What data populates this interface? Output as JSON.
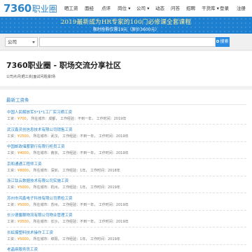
{
  "nav": {
    "logo_num": "7360",
    "logo_text": "职业圈",
    "items": [
      "晒工资",
      "面经",
      "点评",
      "岗位",
      "公司",
      "动态",
      "问答",
      "招聘",
      "干货库"
    ],
    "login": "登录",
    "register": "注册"
  },
  "banner": {
    "headline": "2019最新成为HR专家的100门必修课全套课程",
    "subline": "限时抢购仅需19元（原价3600元）"
  },
  "search": {
    "category": "公司",
    "query": "",
    "button": "搜索"
  },
  "company": {
    "title": "7360职业圈 - 职场交流分享社区",
    "subtitle": "公司点评|晒工资|面试问题|职场"
  },
  "jobs_section": {
    "heading": "最新工资条",
    "items": [
      {
        "name": "中国人民解放军5*1*1工厂实习晒工资",
        "salary": "¥700",
        "city": "成都",
        "exp": "不到一年",
        "year": "2019年"
      },
      {
        "name": "武汉鑫灵创信息技术有限公司销售工资",
        "salary": "¥2500",
        "city": "武汉",
        "exp": "不到一年",
        "year": "2019年"
      },
      {
        "name": "中国邮政储蓄银行有限行柜员工资",
        "salary": "¥4000",
        "city": "南京",
        "exp": "不到一年",
        "year": "2019年"
      },
      {
        "name": "京和通通工程师工资",
        "salary": "¥8000",
        "city": "深圳",
        "exp": "1年",
        "year": "2018年"
      },
      {
        "name": "浙江钛云数据技术有限公司实施工资",
        "salary": "¥5000",
        "city": "杭州",
        "exp": "1年",
        "year": "2019年"
      },
      {
        "name": "苏州市鸿鑫电子科技有限公司质检工资",
        "salary": "¥5000",
        "city": "苏州",
        "exp": "不到一年",
        "year": "2019年"
      },
      {
        "name": "长沙德馨酿物流有限公司物业管理工资",
        "salary": "¥3500",
        "city": "长沙",
        "exp": "不到一年",
        "year": "2019年"
      },
      {
        "name": "长虹爆塑料技术操作工工资",
        "salary": "¥5000",
        "city": "绵阳",
        "exp": "1年",
        "year": "2019年"
      },
      {
        "name": "老晶麻服务员工资",
        "salary": "¥2450",
        "city": "太原",
        "exp": "不到一年",
        "year": "2019年"
      }
    ]
  },
  "labels": {
    "salary": "工资：",
    "city": "所在城市：",
    "exp": "工作经验：",
    "year": "工作时间："
  },
  "colors": {
    "brand_blue": "#2f86c8",
    "banner_bg": "#1c7fd0",
    "salary_orange": "#f08a00"
  }
}
